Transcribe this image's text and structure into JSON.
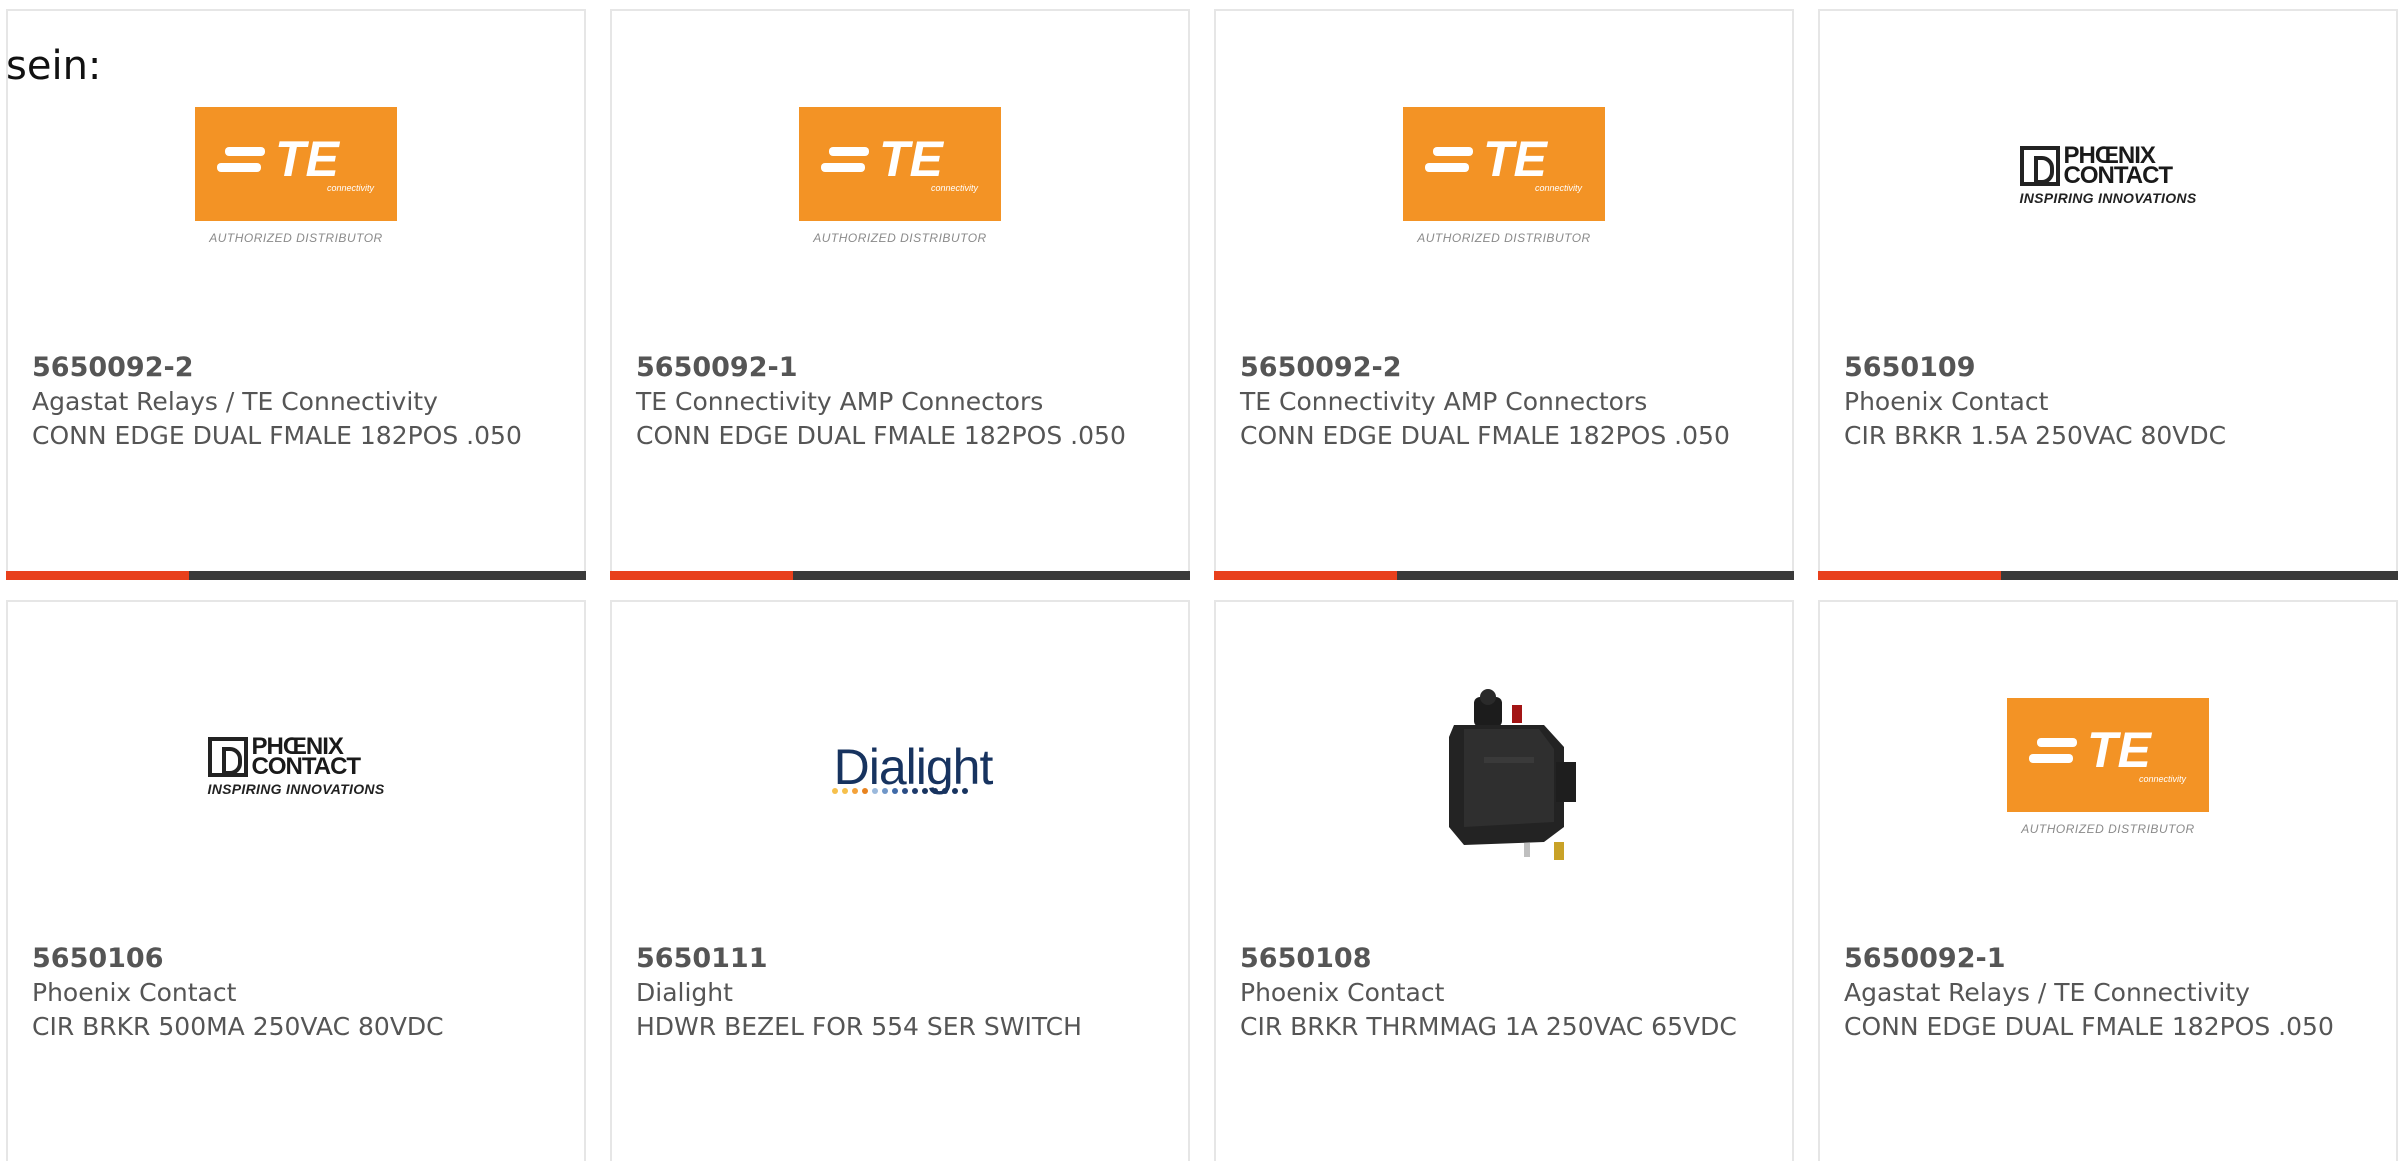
{
  "intro_text": "sein:",
  "colors": {
    "card_border": "#e6e6e6",
    "bar_dark": "#3a3a3a",
    "bar_accent": "#e8401c",
    "te_orange": "#f39325",
    "dialight_blue": "#17335f"
  },
  "products": [
    {
      "sku": "5650092-2",
      "manufacturer": "Agastat Relays / TE Connectivity",
      "description": "CONN EDGE DUAL FMALE 182POS .050",
      "image": "te-connectivity-logo",
      "logo_text": "TE",
      "logo_subtext": "connectivity",
      "logo_caption": "AUTHORIZED DISTRIBUTOR"
    },
    {
      "sku": "5650092-1",
      "manufacturer": "TE Connectivity AMP Connectors",
      "description": "CONN EDGE DUAL FMALE 182POS .050",
      "image": "te-connectivity-logo",
      "logo_text": "TE",
      "logo_subtext": "connectivity",
      "logo_caption": "AUTHORIZED DISTRIBUTOR"
    },
    {
      "sku": "5650092-2",
      "manufacturer": "TE Connectivity AMP Connectors",
      "description": "CONN EDGE DUAL FMALE 182POS .050",
      "image": "te-connectivity-logo",
      "logo_text": "TE",
      "logo_subtext": "connectivity",
      "logo_caption": "AUTHORIZED DISTRIBUTOR"
    },
    {
      "sku": "5650109",
      "manufacturer": "Phoenix Contact",
      "description": "CIR BRKR 1.5A 250VAC 80VDC",
      "image": "phoenix-contact-logo",
      "logo_line1": "PHŒNIX",
      "logo_line2": "CONTACT",
      "logo_caption": "INSPIRING INNOVATIONS"
    },
    {
      "sku": "5650106",
      "manufacturer": "Phoenix Contact",
      "description": "CIR BRKR 500MA 250VAC 80VDC",
      "image": "phoenix-contact-logo",
      "logo_line1": "PHŒNIX",
      "logo_line2": "CONTACT",
      "logo_caption": "INSPIRING INNOVATIONS"
    },
    {
      "sku": "5650111",
      "manufacturer": "Dialight",
      "description": "HDWR BEZEL FOR 554 SER SWITCH",
      "image": "dialight-logo",
      "logo_text": "Dialight"
    },
    {
      "sku": "5650108",
      "manufacturer": "Phoenix Contact",
      "description": "CIR BRKR THRMMAG 1A 250VAC 65VDC",
      "image": "circuit-breaker-photo"
    },
    {
      "sku": "5650092-1",
      "manufacturer": "Agastat Relays / TE Connectivity",
      "description": "CONN EDGE DUAL FMALE 182POS .050",
      "image": "te-connectivity-logo",
      "logo_text": "TE",
      "logo_subtext": "connectivity",
      "logo_caption": "AUTHORIZED DISTRIBUTOR"
    }
  ]
}
